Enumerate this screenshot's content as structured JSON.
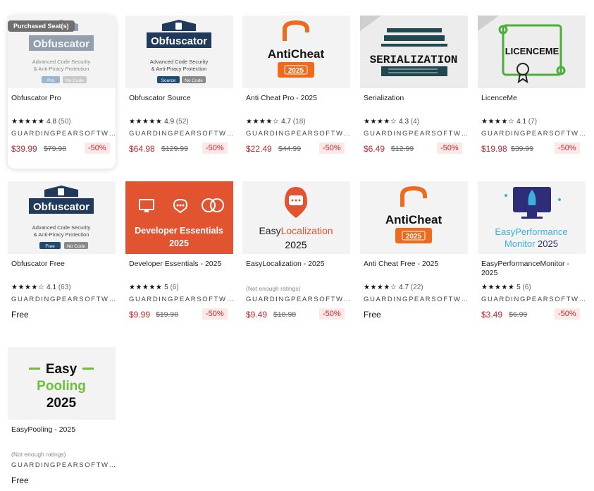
{
  "badge": "Purchased Seat(s)",
  "publisher": "GUARDINGPEARSOFTW…",
  "products": [
    {
      "title": "Obfuscator Pro",
      "rating": "4.8",
      "count": "(50)",
      "price": "$39.99",
      "old": "$79.98",
      "discount": "-50%"
    },
    {
      "title": "Obfuscator Source",
      "rating": "4.9",
      "count": "(52)",
      "price": "$64.98",
      "old": "$129.99",
      "discount": "-50%"
    },
    {
      "title": "Anti Cheat Pro - 2025",
      "rating": "4.7",
      "count": "(18)",
      "price": "$22.49",
      "old": "$44.99",
      "discount": "-50%"
    },
    {
      "title": "Serialization",
      "rating": "4.3",
      "count": "(4)",
      "price": "$6.49",
      "old": "$12.99",
      "discount": "-50%"
    },
    {
      "title": "LicenceMe",
      "rating": "4.1",
      "count": "(7)",
      "price": "$19.98",
      "old": "$39.99",
      "discount": "-50%"
    },
    {
      "title": "Obfuscator Free",
      "rating": "4.1",
      "count": "(63)",
      "price": "Free"
    },
    {
      "title": "Developer Essentials - 2025",
      "rating": "5",
      "count": "(6)",
      "price": "$9.99",
      "old": "$19.98",
      "discount": "-50%"
    },
    {
      "title": "EasyLocalization - 2025",
      "no_ratings": "(Not enough ratings)",
      "price": "$9.49",
      "old": "$18.98",
      "discount": "-50%"
    },
    {
      "title": "Anti Cheat Free - 2025",
      "rating": "4.7",
      "count": "(22)",
      "price": "Free"
    },
    {
      "title": "EasyPerformanceMonitor - 2025",
      "rating": "5",
      "count": "(6)",
      "price": "$3.49",
      "old": "$6.99",
      "discount": "-50%"
    },
    {
      "title": "EasyPooling - 2025",
      "no_ratings": "(Not enough ratings)",
      "price": "Free"
    }
  ],
  "thumbs": {
    "obf": {
      "name": "Obfuscator",
      "line1": "Advanced Code Security",
      "line2": "& Anti-Piracy Protection"
    },
    "obf_pro_tags": [
      "Pro",
      "No Code"
    ],
    "obf_src_tags": [
      "Source",
      "No Code"
    ],
    "obf_free_tags": [
      "Free",
      "No Code"
    ],
    "anticheat": {
      "name": "AntiCheat",
      "year": "2025"
    },
    "serialization": "SERIALIZATION",
    "licenceme": "LICENCEME",
    "devess": {
      "line1": "Developer Essentials",
      "line2": "2025"
    },
    "easyloc": {
      "easy": "Easy",
      "rest": "Localization",
      "year": "2025"
    },
    "easyperf": {
      "easy": "Easy",
      "rest": "Performance",
      "line2": "Monitor",
      "year": "2025"
    },
    "easypool": {
      "line1": "Easy",
      "line2": "Pooling",
      "year": "2025"
    }
  },
  "colors": {
    "price": "#c0262d",
    "orange": "#f06a1d",
    "navy": "#1f3a5a",
    "red_tile": "#e2542f"
  }
}
